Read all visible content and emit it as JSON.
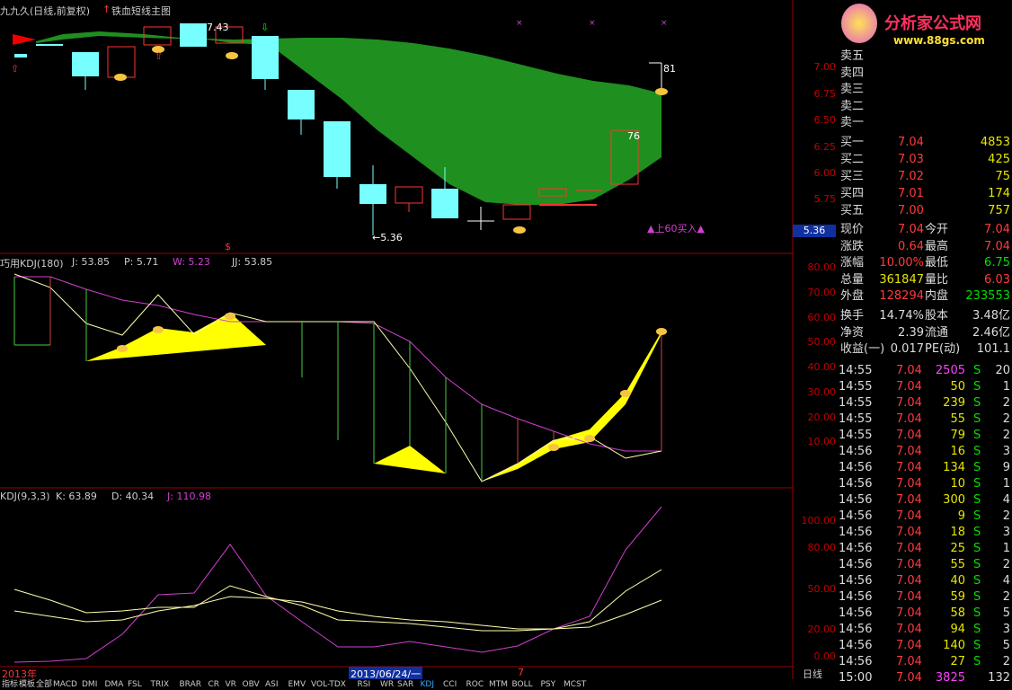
{
  "main": {
    "title": "九九久(日线,前复权)",
    "formula": "铁血短线主图",
    "price_labels": [
      "7.00",
      "6.75",
      "6.50",
      "6.25",
      "6.00",
      "5.75"
    ],
    "hi_label": "7.43",
    "lo_label": "←5.36",
    "mark81": "81",
    "mark76": "76",
    "buy_signal": "▲上60买入▲",
    "current_price_tag": "5.36",
    "dollar": "$"
  },
  "kdj180": {
    "title": "巧用KDJ(180)",
    "j": "J: 53.85",
    "p": "P: 5.71",
    "w": "W: 5.23",
    "jj": "JJ: 53.85",
    "levels": [
      "80.00",
      "70.00",
      "60.00",
      "50.00",
      "40.00",
      "30.00",
      "20.00",
      "10.00"
    ]
  },
  "kdj": {
    "title": "KDJ(9,3,3)",
    "k": "K: 63.89",
    "d": "D: 40.34",
    "j": "J: 110.98",
    "levels": [
      "100.00",
      "80.00",
      "50.00",
      "20.00",
      "0.00"
    ]
  },
  "timeline": {
    "year": "2013年",
    "date": "2013/06/24/一",
    "seven": "7",
    "period": "日线"
  },
  "tabs": [
    "指标",
    "模板",
    "全部",
    "MACD",
    "DMI",
    "DMA",
    "FSL",
    "TRIX",
    "BRAR",
    "CR",
    "VR",
    "OBV",
    "ASI",
    "EMV",
    "VOL-TDX",
    "RSI",
    "WR",
    "SAR",
    "KDJ",
    "CCI",
    "ROC",
    "MTM",
    "BOLL",
    "PSY",
    "MCST"
  ],
  "logo": {
    "name": "分析家公式网",
    "url": "www.88gs.com"
  },
  "order_book": {
    "sells": [
      "卖五",
      "卖四",
      "卖三",
      "卖二",
      "卖一"
    ],
    "buys": [
      {
        "label": "买一",
        "price": "7.04",
        "vol": "4853"
      },
      {
        "label": "买二",
        "price": "7.03",
        "vol": "425"
      },
      {
        "label": "买三",
        "price": "7.02",
        "vol": "75"
      },
      {
        "label": "买四",
        "price": "7.01",
        "vol": "174"
      },
      {
        "label": "买五",
        "price": "7.00",
        "vol": "757"
      }
    ]
  },
  "quote": [
    {
      "l1": "现价",
      "v1": "7.04",
      "l2": "今开",
      "v2": "7.04"
    },
    {
      "l1": "涨跌",
      "v1": "0.64",
      "l2": "最高",
      "v2": "7.04"
    },
    {
      "l1": "涨幅",
      "v1": "10.00%",
      "l2": "最低",
      "v2": "6.75"
    },
    {
      "l1": "总量",
      "v1": "361847",
      "l2": "量比",
      "v2": "6.03"
    },
    {
      "l1": "外盘",
      "v1": "128294",
      "l2": "内盘",
      "v2": "233553"
    },
    {
      "l1": "换手",
      "v1": "14.74%",
      "l2": "股本",
      "v2": "3.48亿"
    },
    {
      "l1": "净资",
      "v1": "2.39",
      "l2": "流通",
      "v2": "2.46亿"
    },
    {
      "l1": "收益(一)",
      "v1": "0.017",
      "l2": "PE(动)",
      "v2": "101.1"
    }
  ],
  "ticks": [
    {
      "t": "14:55",
      "p": "7.04",
      "v": "2505",
      "s": "S",
      "n": "20"
    },
    {
      "t": "14:55",
      "p": "7.04",
      "v": "50",
      "s": "S",
      "n": "1"
    },
    {
      "t": "14:55",
      "p": "7.04",
      "v": "239",
      "s": "S",
      "n": "2"
    },
    {
      "t": "14:55",
      "p": "7.04",
      "v": "55",
      "s": "S",
      "n": "2"
    },
    {
      "t": "14:55",
      "p": "7.04",
      "v": "79",
      "s": "S",
      "n": "2"
    },
    {
      "t": "14:56",
      "p": "7.04",
      "v": "16",
      "s": "S",
      "n": "3"
    },
    {
      "t": "14:56",
      "p": "7.04",
      "v": "134",
      "s": "S",
      "n": "9"
    },
    {
      "t": "14:56",
      "p": "7.04",
      "v": "10",
      "s": "S",
      "n": "1"
    },
    {
      "t": "14:56",
      "p": "7.04",
      "v": "300",
      "s": "S",
      "n": "4"
    },
    {
      "t": "14:56",
      "p": "7.04",
      "v": "9",
      "s": "S",
      "n": "2"
    },
    {
      "t": "14:56",
      "p": "7.04",
      "v": "18",
      "s": "S",
      "n": "3"
    },
    {
      "t": "14:56",
      "p": "7.04",
      "v": "25",
      "s": "S",
      "n": "1"
    },
    {
      "t": "14:56",
      "p": "7.04",
      "v": "55",
      "s": "S",
      "n": "2"
    },
    {
      "t": "14:56",
      "p": "7.04",
      "v": "40",
      "s": "S",
      "n": "4"
    },
    {
      "t": "14:56",
      "p": "7.04",
      "v": "59",
      "s": "S",
      "n": "2"
    },
    {
      "t": "14:56",
      "p": "7.04",
      "v": "58",
      "s": "S",
      "n": "5"
    },
    {
      "t": "14:56",
      "p": "7.04",
      "v": "94",
      "s": "S",
      "n": "3"
    },
    {
      "t": "14:56",
      "p": "7.04",
      "v": "140",
      "s": "S",
      "n": "5"
    },
    {
      "t": "14:56",
      "p": "7.04",
      "v": "27",
      "s": "S",
      "n": "2"
    },
    {
      "t": "15:00",
      "p": "7.04",
      "v": "3825",
      "s": "",
      "n": "132"
    }
  ]
}
